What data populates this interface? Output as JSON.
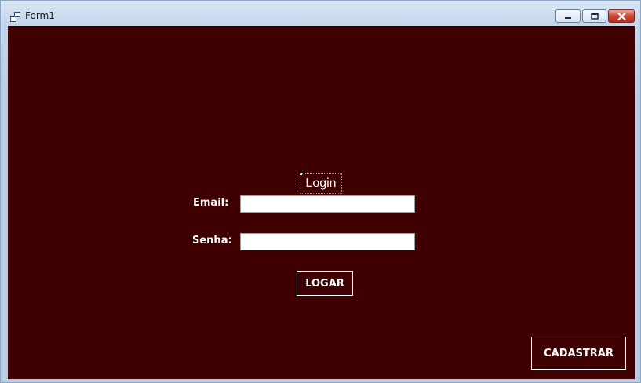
{
  "window": {
    "title": "Form1",
    "controls": {
      "minimize": "minimize-icon",
      "maximize": "maximize-icon",
      "close": "close-icon"
    }
  },
  "form": {
    "heading": "Login",
    "email_label": "Email:",
    "email_value": "",
    "password_label": "Senha:",
    "password_value": "",
    "login_button": "LOGAR",
    "register_button": "CADASTRAR"
  },
  "colors": {
    "client_background": "#3e0000",
    "text": "#ffffff"
  }
}
